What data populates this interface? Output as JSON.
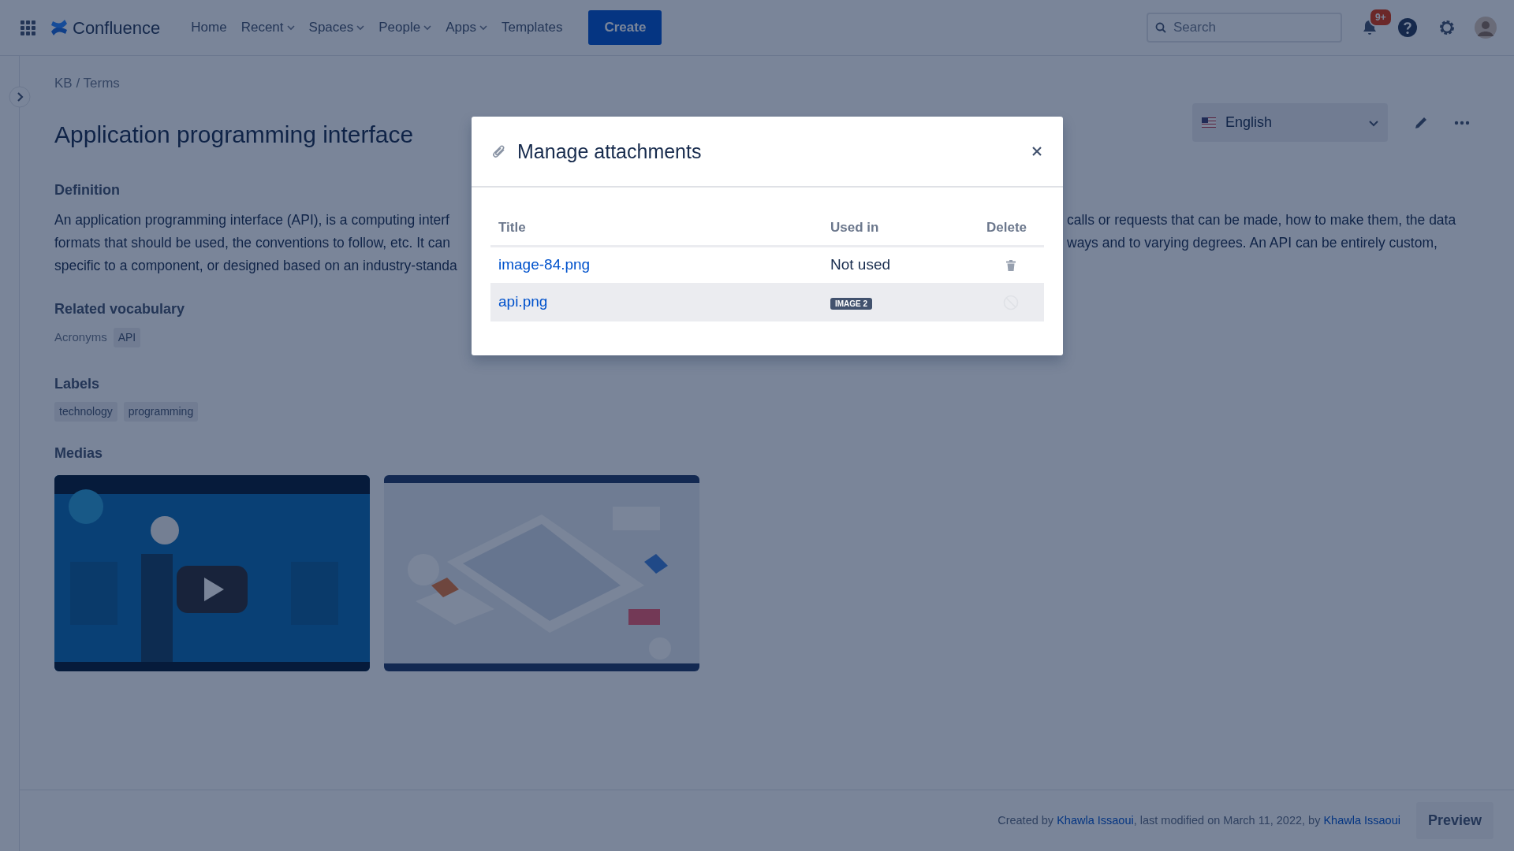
{
  "topbar": {
    "logo_text": "Confluence",
    "nav": [
      {
        "label": "Home",
        "dropdown": false
      },
      {
        "label": "Recent",
        "dropdown": true
      },
      {
        "label": "Spaces",
        "dropdown": true
      },
      {
        "label": "People",
        "dropdown": true
      },
      {
        "label": "Apps",
        "dropdown": true
      },
      {
        "label": "Templates",
        "dropdown": false
      }
    ],
    "create_button": "Create",
    "search": {
      "placeholder": "Search"
    },
    "notification_badge": "9+"
  },
  "page": {
    "breadcrumb": "KB / Terms",
    "title": "Application programming interface",
    "language": "English",
    "definition_heading": "Definition",
    "definition_left": [
      "An application programming interface (API), is a computing interf",
      "formats that should be used, the conventions to follow, etc. It can",
      "specific to a component, or designed based on an industry-standa"
    ],
    "definition_right": [
      "calls or requests that can be made, how to make them, the data",
      "ways and to varying degrees. An API can be entirely custom,"
    ],
    "related_heading": "Related vocabulary",
    "related_label": "Acronyms",
    "related_tags": [
      "API"
    ],
    "labels_heading": "Labels",
    "labels": [
      "technology",
      "programming"
    ],
    "medias_heading": "Medias",
    "medias": [
      {
        "kind": "picture"
      },
      {
        "kind": "picture"
      }
    ],
    "footer": [
      {
        "kind": "text",
        "text": "Created by "
      },
      {
        "kind": "link",
        "text": "Khawla Issaoui"
      },
      {
        "kind": "text",
        "text": ", last modified on March 11, 2022, by "
      },
      {
        "kind": "link",
        "text": "Khawla Issaoui"
      }
    ],
    "preview_button": "Preview"
  },
  "dialog": {
    "title": "Manage attachments",
    "columns": [
      "Title",
      "Used in",
      "Delete"
    ],
    "rows": [
      {
        "title": "image-84.png",
        "used_in": {
          "kind": "text",
          "text": "Not used"
        },
        "deletable": true,
        "highlighted": false
      },
      {
        "title": "api.png",
        "used_in": {
          "kind": "tag",
          "text": "IMAGE 2"
        },
        "deletable": false,
        "highlighted": true
      }
    ]
  }
}
